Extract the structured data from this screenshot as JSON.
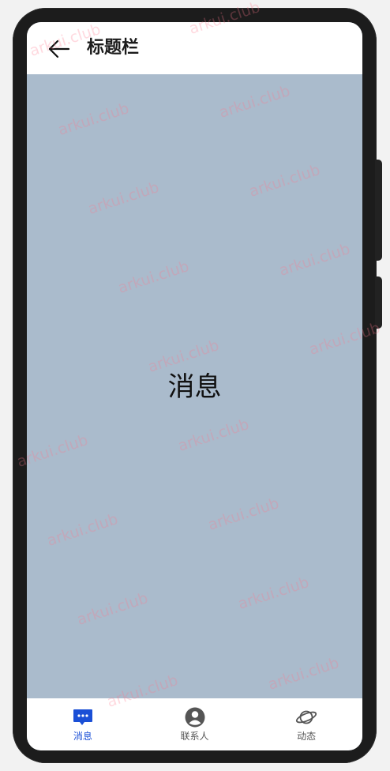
{
  "title_bar": {
    "back_icon": "arrow-left-icon",
    "title": "标题栏"
  },
  "content": {
    "text": "消息",
    "background": "#aabbcc"
  },
  "tab_bar": {
    "active_color": "#1a4fd6",
    "tabs": [
      {
        "label": "消息",
        "icon": "message-icon",
        "active": true
      },
      {
        "label": "联系人",
        "icon": "contact-icon",
        "active": false
      },
      {
        "label": "动态",
        "icon": "planet-icon",
        "active": false
      }
    ]
  },
  "watermark": {
    "text": "arkui.club",
    "color": "#ff788c"
  }
}
